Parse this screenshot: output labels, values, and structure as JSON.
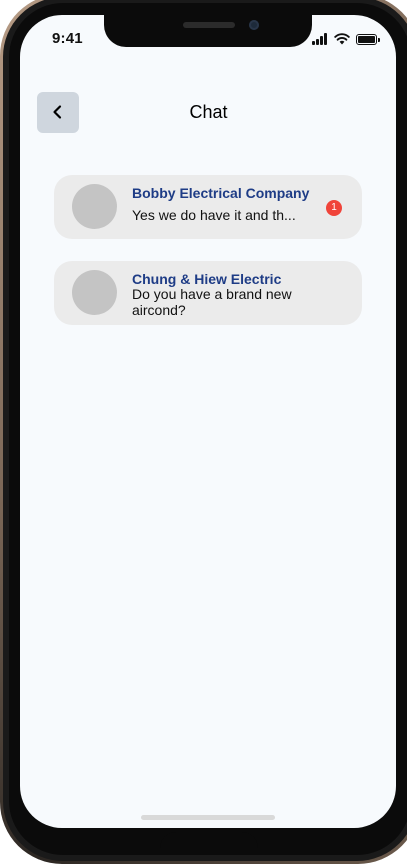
{
  "status_bar": {
    "time": "9:41"
  },
  "header": {
    "title": "Chat",
    "back_icon": "chevron-left-icon"
  },
  "chats": [
    {
      "name": "Bobby Electrical Company",
      "message": "Yes we do have it and th...",
      "unread": "1"
    },
    {
      "name": "Chung & Hiew Electric",
      "message": "Do you have a brand new aircond?"
    }
  ],
  "colors": {
    "name_text": "#1e3c86",
    "badge": "#f0443a",
    "card": "#ebebeb",
    "screen_bg": "#f7fafd",
    "back_button": "#cfd6de"
  }
}
